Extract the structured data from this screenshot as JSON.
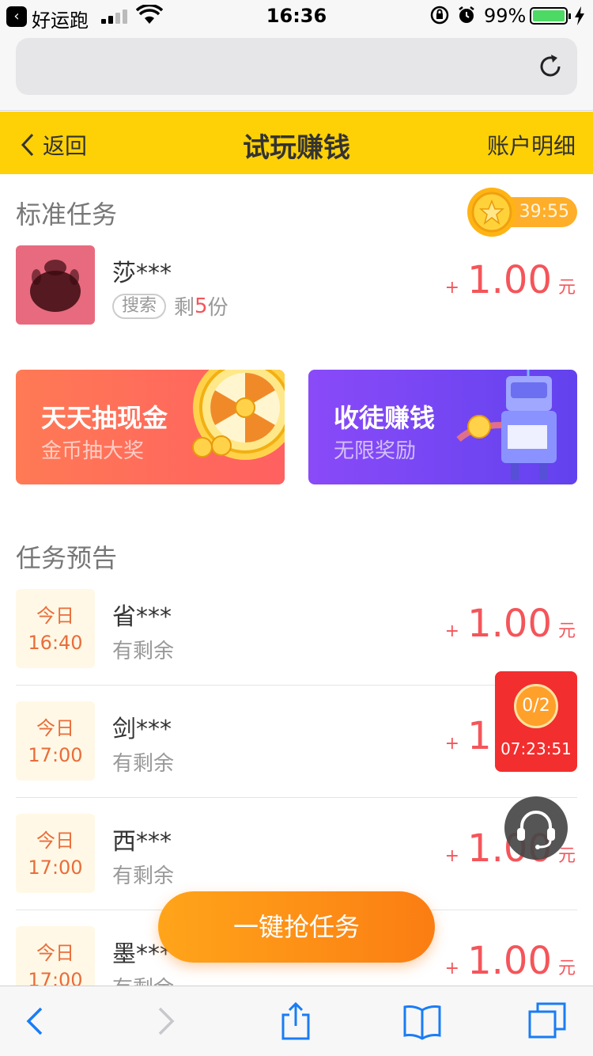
{
  "status_bar": {
    "back_app": "好运跑",
    "time": "16:36",
    "battery_pct": "99%"
  },
  "header": {
    "back_label": "返回",
    "title": "试玩赚钱",
    "detail_label": "账户明细"
  },
  "standard_tasks": {
    "section_title": "标准任务",
    "timer": "39:55",
    "items": [
      {
        "name": "莎***",
        "tag": "搜索",
        "remain_prefix": "剩",
        "remain_count": "5",
        "remain_suffix": "份",
        "plus": "+",
        "amount": "1.00",
        "unit": "元"
      }
    ]
  },
  "banners": {
    "left": {
      "title": "天天抽现金",
      "subtitle": "金币抽大奖"
    },
    "right": {
      "title": "收徒赚钱",
      "subtitle": "无限奖励"
    }
  },
  "preview": {
    "section_title": "任务预告",
    "items": [
      {
        "day": "今日",
        "time": "16:40",
        "name": "省***",
        "status": "有剩余",
        "plus": "+",
        "amount": "1.00",
        "unit": "元"
      },
      {
        "day": "今日",
        "time": "17:00",
        "name": "剑***",
        "status": "有剩余",
        "plus": "+",
        "amount": "1.00",
        "unit": "元"
      },
      {
        "day": "今日",
        "time": "17:00",
        "name": "西***",
        "status": "有剩余",
        "plus": "+",
        "amount": "1.00",
        "unit": "元"
      },
      {
        "day": "今日",
        "time": "17:00",
        "name": "墨***",
        "status": "有剩余",
        "plus": "+",
        "amount": "1.00",
        "unit": "元"
      }
    ]
  },
  "float_countdown": {
    "progress": "0/2",
    "countdown": "07:23:51"
  },
  "grab_button": {
    "label": "一键抢任务"
  },
  "icons": {
    "service": "headset-icon",
    "toolbar": [
      "back-arrow-icon",
      "forward-arrow-icon",
      "share-icon",
      "bookmarks-icon",
      "tabs-icon"
    ]
  },
  "colors": {
    "header_bg": "#fdd106",
    "price": "#f4555a",
    "grab_button": "#fb7d13"
  }
}
